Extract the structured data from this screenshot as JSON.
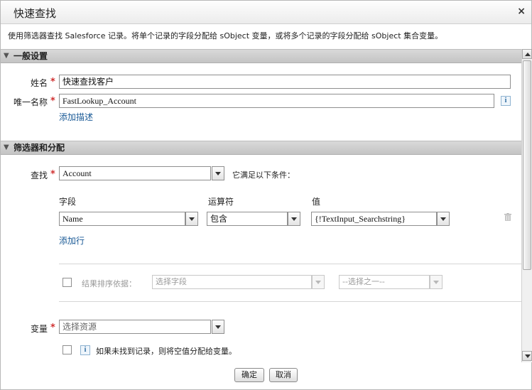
{
  "dialog": {
    "title": "快速查找",
    "close_label": "×",
    "description": "使用筛选器查找 Salesforce 记录。将单个记录的字段分配给 sObject 变量，或将多个记录的字段分配给 sObject 集合变量。"
  },
  "general": {
    "header": "一般设置",
    "name_label": "姓名",
    "name_value": "快速查找客户",
    "unique_label": "唯一名称",
    "unique_value": "FastLookup_Account",
    "add_description": "添加描述",
    "info_icon_text": "i"
  },
  "filters": {
    "header": "筛选器和分配",
    "lookup_label": "查找",
    "lookup_value": "Account",
    "condition_text": "它满足以下条件：",
    "col_field": "字段",
    "col_operator": "运算符",
    "col_value": "值",
    "row": {
      "field": "Name",
      "operator": "包含",
      "value": "{!TextInput_Searchstring}"
    },
    "add_row": "添加行",
    "sort_label": "结果排序依据：",
    "sort_field_placeholder": "选择字段",
    "sort_order_placeholder": "--选择之一--",
    "variable_label": "变量",
    "variable_placeholder": "选择资源",
    "null_note": "如果未找到记录，则将空值分配给变量。"
  },
  "footer": {
    "ok": "确定",
    "cancel": "取消"
  },
  "required_mark": "*"
}
